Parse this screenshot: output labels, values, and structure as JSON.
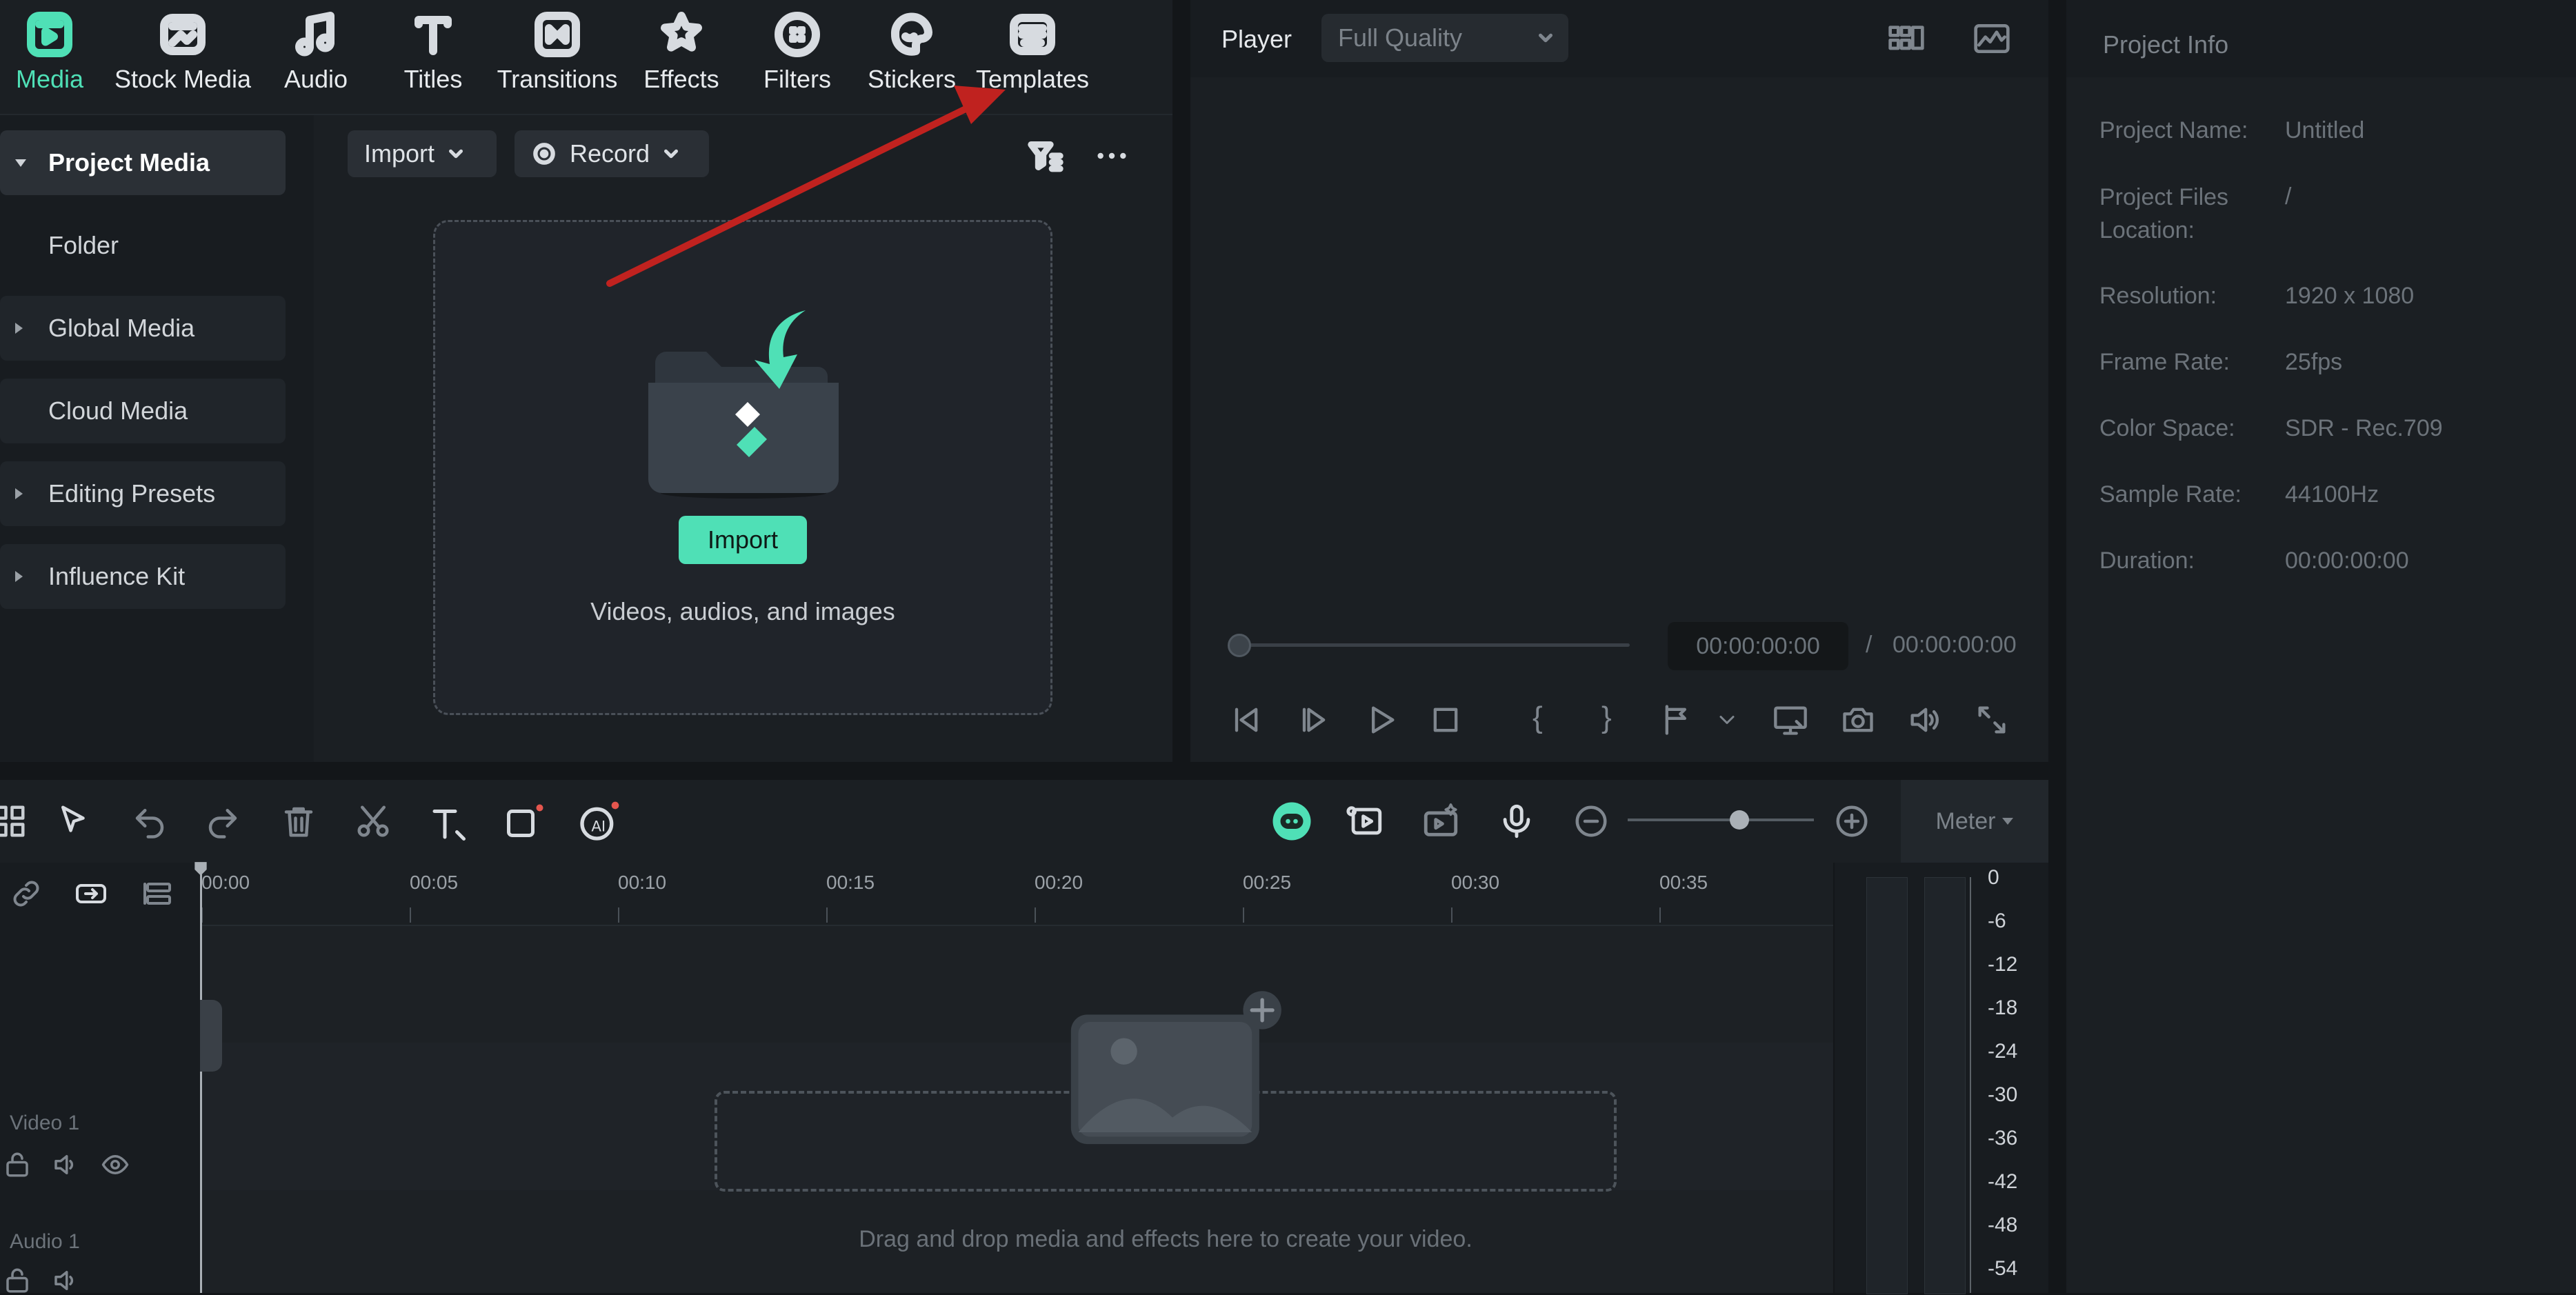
{
  "top_tabs": [
    {
      "label": "Media",
      "icon": "media-icon",
      "active": true
    },
    {
      "label": "Stock Media",
      "icon": "stock-media-icon"
    },
    {
      "label": "Audio",
      "icon": "audio-icon"
    },
    {
      "label": "Titles",
      "icon": "titles-icon"
    },
    {
      "label": "Transitions",
      "icon": "transitions-icon"
    },
    {
      "label": "Effects",
      "icon": "effects-icon"
    },
    {
      "label": "Filters",
      "icon": "filters-icon"
    },
    {
      "label": "Stickers",
      "icon": "stickers-icon"
    },
    {
      "label": "Templates",
      "icon": "templates-icon"
    }
  ],
  "sidebar": {
    "items": [
      {
        "label": "Project Media",
        "expanded": true,
        "active": true
      },
      {
        "label": "Folder"
      },
      {
        "label": "Global Media",
        "expandable": true
      },
      {
        "label": "Cloud Media"
      },
      {
        "label": "Editing Presets",
        "expandable": true
      },
      {
        "label": "Influence Kit",
        "expandable": true
      }
    ]
  },
  "media_toolbar": {
    "import_label": "Import",
    "record_label": "Record"
  },
  "dropzone": {
    "import_button": "Import",
    "hint": "Videos, audios, and images"
  },
  "player": {
    "title": "Player",
    "quality": "Full Quality",
    "current_time": "00:00:00:00",
    "separator": "/",
    "total_time": "00:00:00:00",
    "progress": 0
  },
  "project_info": {
    "title": "Project Info",
    "rows": [
      {
        "label": "Project Name:",
        "value": "Untitled"
      },
      {
        "label": "Project Files Location:",
        "value": "/"
      },
      {
        "label": "Resolution:",
        "value": "1920 x 1080"
      },
      {
        "label": "Frame Rate:",
        "value": "25fps"
      },
      {
        "label": "Color Space:",
        "value": "SDR - Rec.709"
      },
      {
        "label": "Sample Rate:",
        "value": "44100Hz"
      },
      {
        "label": "Duration:",
        "value": "00:00:00:00"
      }
    ]
  },
  "timeline": {
    "ruler": [
      "00:00",
      "00:05",
      "00:10",
      "00:15",
      "00:20",
      "00:25",
      "00:30",
      "00:35"
    ],
    "tracks": [
      {
        "label": "Video 1"
      },
      {
        "label": "Audio 1"
      }
    ],
    "empty_hint": "Drag and drop media and effects here to create your video.",
    "zoom_level": 0.6
  },
  "meter": {
    "label": "Meter",
    "scale": [
      "0",
      "-6",
      "-12",
      "-18",
      "-24",
      "-30",
      "-36",
      "-42",
      "-48",
      "-54"
    ]
  },
  "colors": {
    "accent": "#4fe0b6",
    "annotation_arrow": "#c0221f",
    "background": "#131619",
    "panel": "#1b1f23"
  }
}
